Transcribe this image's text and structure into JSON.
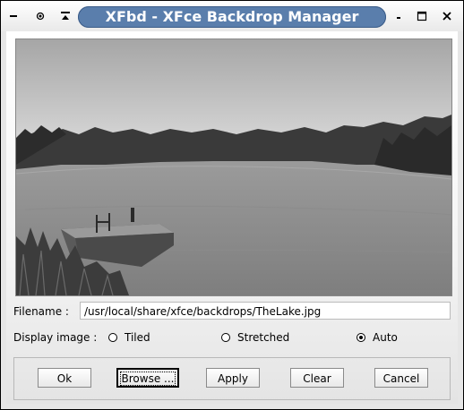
{
  "window": {
    "title": "XFbd - XFce Backdrop Manager",
    "left_buttons": [
      "close-icon",
      "sticky-icon",
      "shade-icon"
    ],
    "right_buttons": [
      "minimize-icon",
      "maximize-icon",
      "close-icon"
    ]
  },
  "filename": {
    "label": "Filename :",
    "value": "/usr/local/share/xfce/backdrops/TheLake.jpg"
  },
  "display": {
    "label": "Display image :",
    "options": [
      {
        "label": "Tiled",
        "selected": false
      },
      {
        "label": "Stretched",
        "selected": false
      },
      {
        "label": "Auto",
        "selected": true
      }
    ]
  },
  "buttons": {
    "ok": "Ok",
    "browse": "Browse ...",
    "apply": "Apply",
    "clear": "Clear",
    "cancel": "Cancel"
  }
}
